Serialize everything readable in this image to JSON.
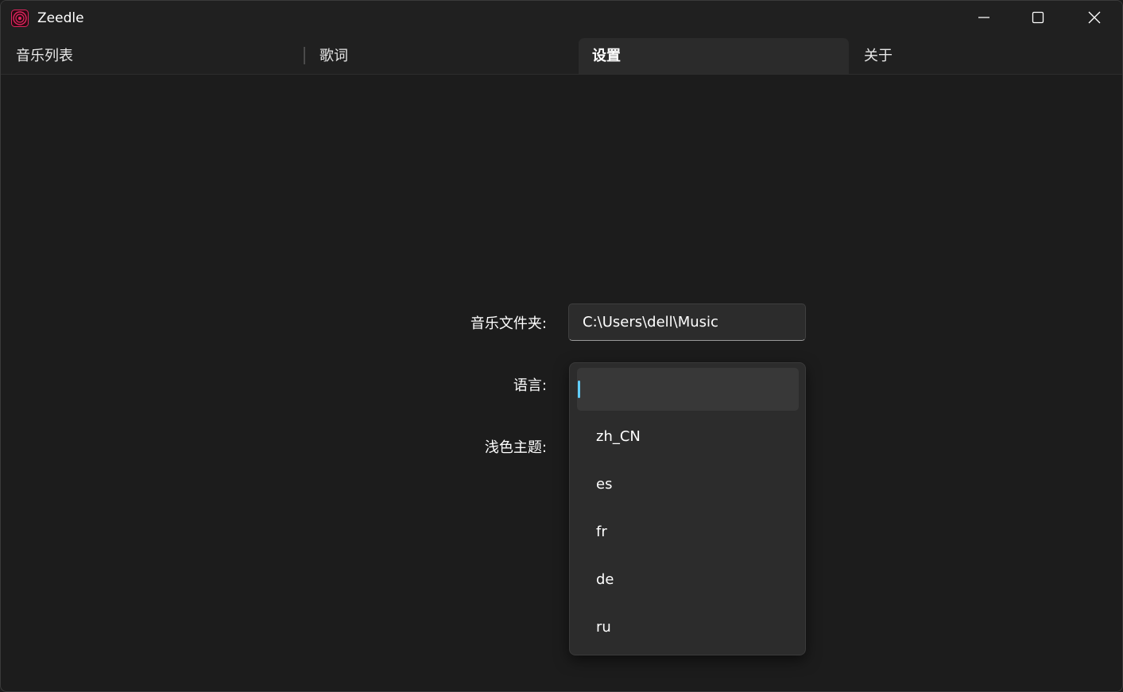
{
  "window": {
    "title": "Zeedle"
  },
  "tabs": [
    {
      "label": "音乐列表"
    },
    {
      "label": "歌词"
    },
    {
      "label": "设置"
    },
    {
      "label": "关于"
    }
  ],
  "settings": {
    "music_folder_label": "音乐文件夹:",
    "music_folder_value": "C:\\Users\\dell\\Music",
    "language_label": "语言:",
    "light_theme_label": "浅色主题:"
  },
  "language_dropdown": {
    "options": [
      "",
      "zh_CN",
      "es",
      "fr",
      "de",
      "ru"
    ],
    "selected_index": 0
  },
  "colors": {
    "accent": "#60cdff",
    "background": "#1c1c1c",
    "app_icon": "#e0245e"
  },
  "icons": {
    "app": "record-disc-icon",
    "minimize": "minimize-icon",
    "maximize": "maximize-icon",
    "close": "close-icon"
  }
}
